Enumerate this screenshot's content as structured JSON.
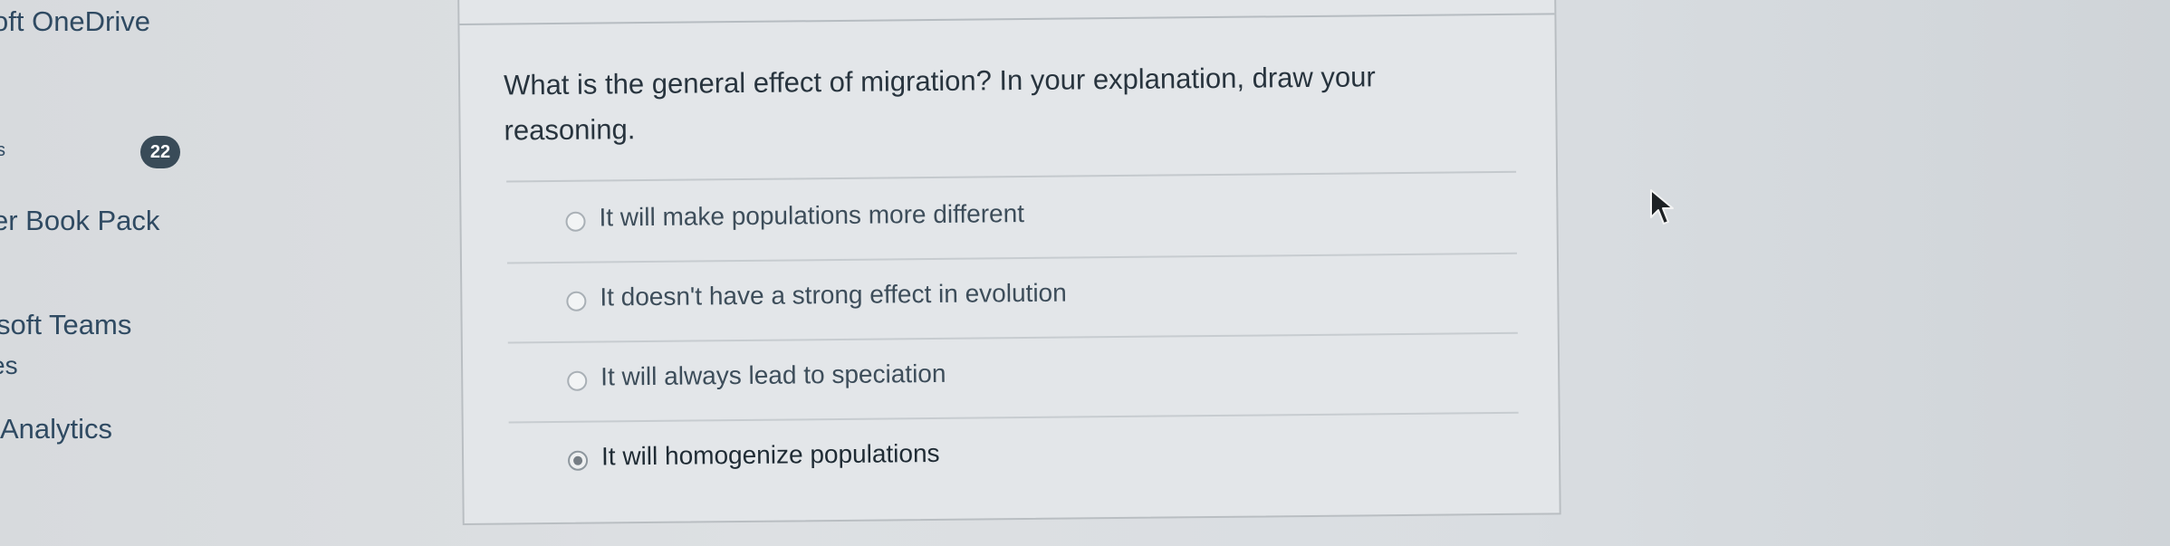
{
  "sidebar": {
    "items": [
      {
        "label": "oft OneDrive"
      },
      {
        "label": "s"
      },
      {
        "label": "er Book Pack"
      },
      {
        "label": "soft Teams"
      },
      {
        "label": "es"
      },
      {
        "label": "Analytics"
      }
    ],
    "badge_count": "22"
  },
  "question": {
    "text": "What is the general effect of migration? In your explanation, draw your reasoning.",
    "answers": [
      {
        "label": "It will make populations more different",
        "selected": false
      },
      {
        "label": "It doesn't have a strong effect in evolution",
        "selected": false
      },
      {
        "label": "It will always lead to speciation",
        "selected": false
      },
      {
        "label": "It will homogenize populations",
        "selected": true
      }
    ]
  },
  "icons": {
    "cursor": "mouse-pointer-icon",
    "radio": "radio-button-icon"
  },
  "colors": {
    "badge_bg": "#394b58",
    "nav_text": "#2f4a62",
    "card_bg": "#e3e6e9"
  }
}
